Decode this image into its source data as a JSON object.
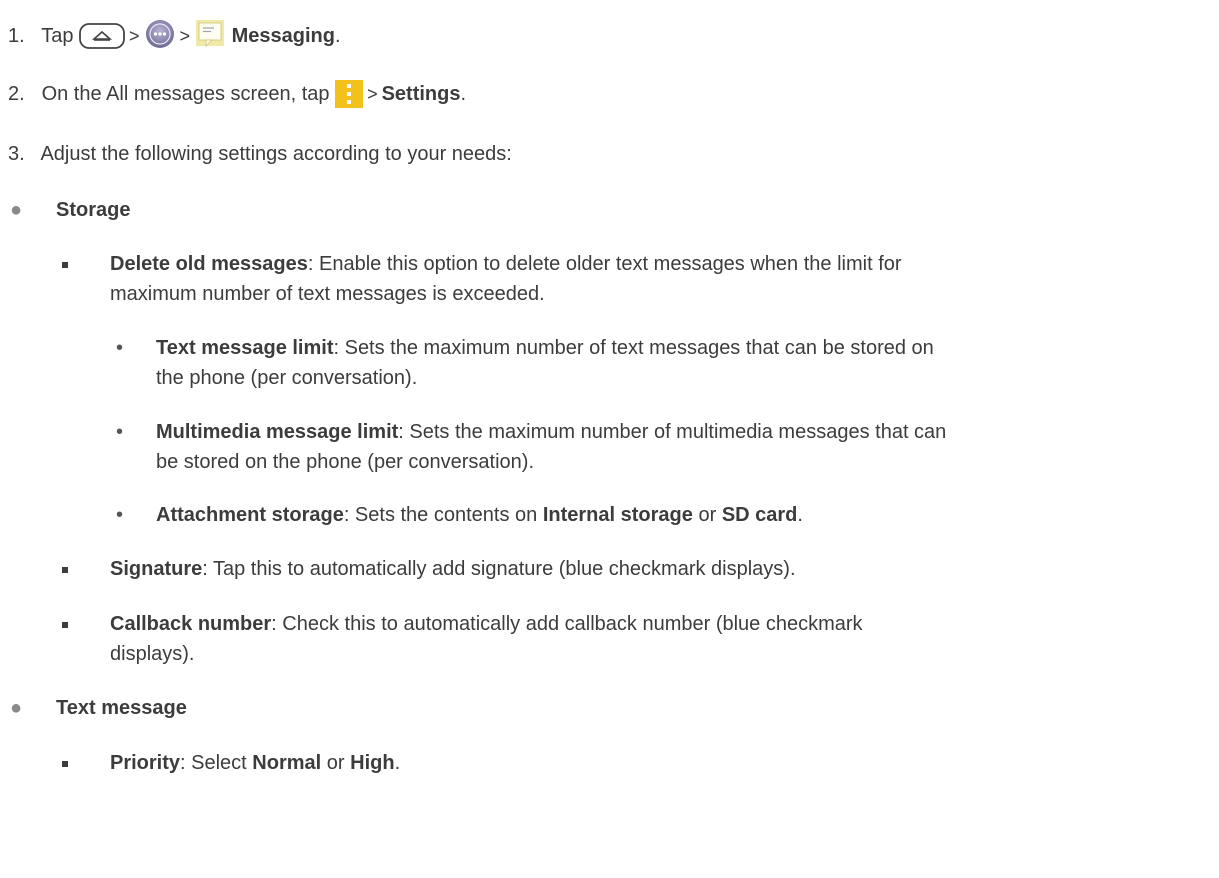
{
  "steps": [
    {
      "num": "1.",
      "pre": "Tap",
      "sep1": ">",
      "sep2": ">",
      "bold": "Messaging",
      "post": "."
    },
    {
      "num": "2.",
      "pre": "On the All messages screen, tap",
      "sep": ">",
      "bold": "Settings",
      "post": "."
    },
    {
      "num": "3.",
      "text": "Adjust the following settings according to your needs:"
    }
  ],
  "icons": [
    "home-key-icon",
    "apps-icon",
    "messaging-app-icon",
    "menu-icon"
  ],
  "storage": {
    "bullet": "●",
    "title": "Storage",
    "delete_old": {
      "bold": "Delete old messages",
      "line1": ": Enable this option to delete older text messages when the limit for",
      "line2": "maximum number of text messages is exceeded."
    },
    "text_limit": {
      "dot": "•",
      "bold": "Text message limit",
      "line1": ": Sets the maximum number of text messages that can be stored on",
      "line2": "the phone (per conversation)."
    },
    "mm_limit": {
      "dot": "•",
      "bold": "Multimedia message limit",
      "line1": ": Sets the maximum number of multimedia messages that can",
      "line2": "be stored on the phone (per conversation)."
    },
    "attachment": {
      "dot": "•",
      "bold": "Attachment storage",
      "text1": ": Sets the contents on",
      "bold2": "Internal storage",
      "text2": "or",
      "bold3": "SD card",
      "text3": "."
    },
    "signature": {
      "bold": "Signature",
      "text": ": Tap this to automatically add signature (blue checkmark displays)."
    },
    "callback": {
      "bold": "Callback number",
      "line1": ": Check this to automatically add callback number (blue checkmark",
      "line2": "displays)."
    }
  },
  "text_message": {
    "bullet": "●",
    "title": "Text message",
    "priority": {
      "bold": "Priority",
      "text1": ": Select",
      "bold2": "Normal",
      "text2": "or",
      "bold3": "High",
      "text3": "."
    }
  }
}
